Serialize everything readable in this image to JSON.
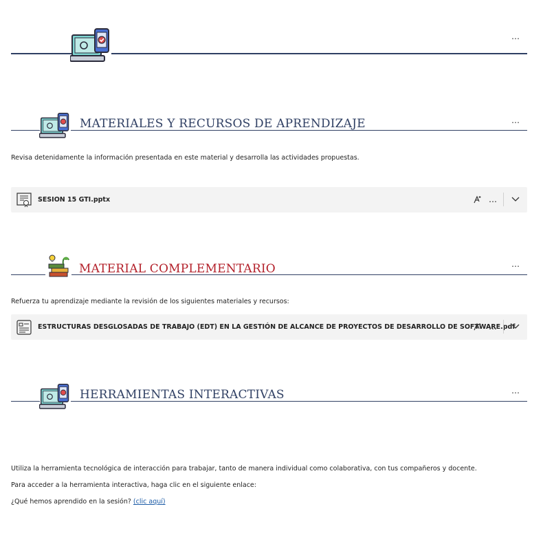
{
  "header": {
    "more_label": "…"
  },
  "sections": [
    {
      "title": "MATERIALES Y RECURSOS DE APRENDIZAJE",
      "title_color": "#2f3f63",
      "description": "Revisa detenidamente la información presentada en este material y desarrolla las actividades propuestas.",
      "file": {
        "name": "SESION 15 GTI.pptx",
        "icon": "presentation-file-icon"
      }
    },
    {
      "title": "MATERIAL COMPLEMENTARIO",
      "title_color": "#b3202a",
      "description": "Refuerza tu aprendizaje mediante la revisión de los siguientes materiales y recursos:",
      "file": {
        "name": "ESTRUCTURAS DESGLOSADAS DE TRABAJO (EDT) EN LA GESTIÓN DE ALCANCE DE PROYECTOS DE DESARROLLO DE SOFTWARE.pdf",
        "icon": "pdf-file-icon"
      }
    },
    {
      "title": "HERRAMIENTAS INTERACTIVAS",
      "title_color": "#2f3f63",
      "paragraphs": [
        "Utiliza la herramienta tecnológica de interacción para trabajar, tanto de manera individual como colaborativa, con tus compañeros y docente.",
        "Para acceder a la herramienta interactiva, haga clic en el siguiente enlace:"
      ],
      "question": "¿Qué hemos aprendido en la sesión?",
      "link_label": "(clic aquí)"
    }
  ],
  "colors": {
    "rule": "#2f3f63",
    "card_bg": "#f3f3f3",
    "link": "#1a5aa6"
  }
}
